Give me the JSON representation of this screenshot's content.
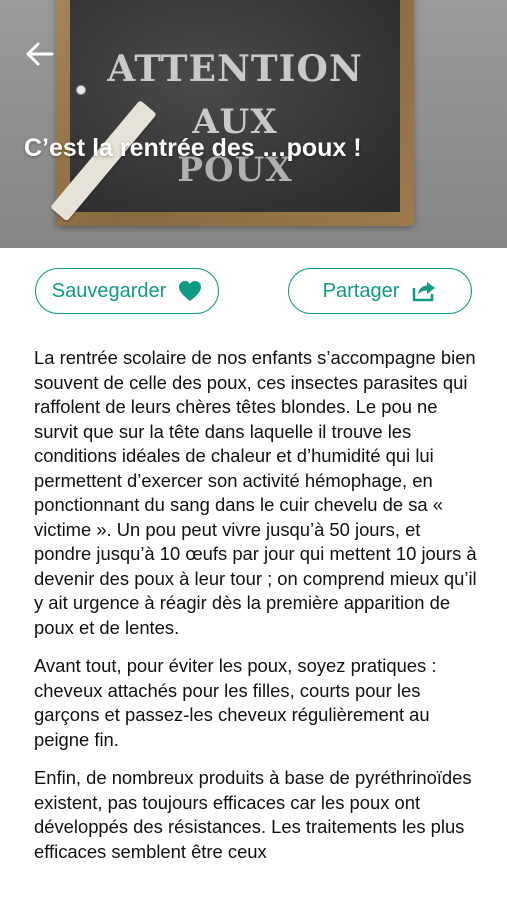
{
  "header": {
    "title": "C’est la rentrée des …poux !",
    "back_icon": "arrow-left-icon",
    "image": {
      "board_line1": "ATTENTION",
      "board_line2": "AUX",
      "board_line3": "POUX"
    }
  },
  "actions": {
    "save_label": "Sauvegarder",
    "save_icon": "heart-icon",
    "share_label": "Partager",
    "share_icon": "share-icon",
    "accent_color": "#0f9a86"
  },
  "article": {
    "paragraphs": [
      "La rentrée scolaire de nos enfants s’accompagne bien souvent de celle des poux,  ces insectes parasites qui raffolent de leurs chères têtes blondes. Le pou ne survit que sur la tête dans laquelle il  trouve les conditions idéales de chaleur et d’humidité qui lui permettent d’exercer son activité hémophage, en ponctionnant du sang dans le cuir chevelu de sa « victime ». Un pou peut vivre jusqu’à 50 jours, et pondre jusqu’à 10 œufs par jour qui mettent  10 jours à devenir des poux à leur tour ; on comprend mieux qu’il y ait urgence à réagir dès la première apparition de poux et de lentes.",
      "Avant tout, pour éviter les poux,  soyez pratiques : cheveux attachés pour les filles, courts pour les garçons et passez-les cheveux régulièrement au peigne fin.",
      "Enfin, de nombreux produits à base de pyréthrinoïdes existent, pas toujours efficaces car les poux ont développés des résistances.  Les traitements les plus efficaces semblent être ceux"
    ]
  }
}
